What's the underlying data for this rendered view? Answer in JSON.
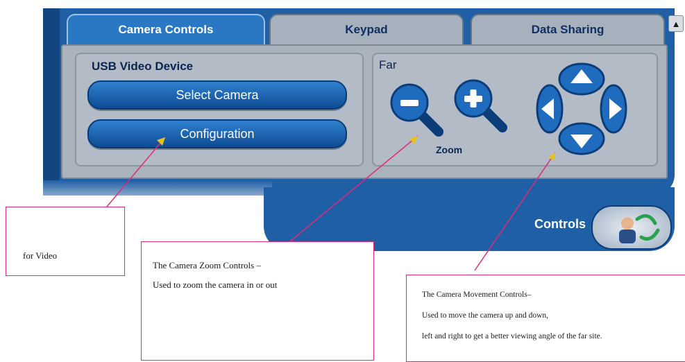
{
  "tabs": [
    {
      "label": "Camera Controls",
      "active": true
    },
    {
      "label": "Keypad",
      "active": false
    },
    {
      "label": "Data Sharing",
      "active": false
    }
  ],
  "video_group": {
    "title": "USB Video Device",
    "select_camera_label": "Select Camera",
    "configuration_label": "Configuration"
  },
  "zoom_group": {
    "site_label": "Far",
    "zoom_label": "Zoom",
    "zoom_out_icon": "zoom-out-icon",
    "zoom_in_icon": "zoom-in-icon"
  },
  "dpad": {
    "icons": [
      "arrow-up-icon",
      "arrow-down-icon",
      "arrow-left-icon",
      "arrow-right-icon"
    ]
  },
  "footer": {
    "controls_label": "Controls",
    "avatar_icon": "controls-avatar-icon"
  },
  "scroll_icon": "scroll-up-icon",
  "callouts": {
    "video": {
      "text": "for Video"
    },
    "zoom": {
      "line1": "The Camera Zoom Controls –",
      "line2": "Used to zoom the camera in or out"
    },
    "movement": {
      "line1": "The Camera Movement Controls–",
      "line2": " Used to move the camera up and down,",
      "line3": "left and right to get a better viewing angle of the far site."
    }
  },
  "colors": {
    "panel_blue": "#1f5fa6",
    "tab_active": "#2a77c3",
    "callout_border": "#e02a7a"
  }
}
